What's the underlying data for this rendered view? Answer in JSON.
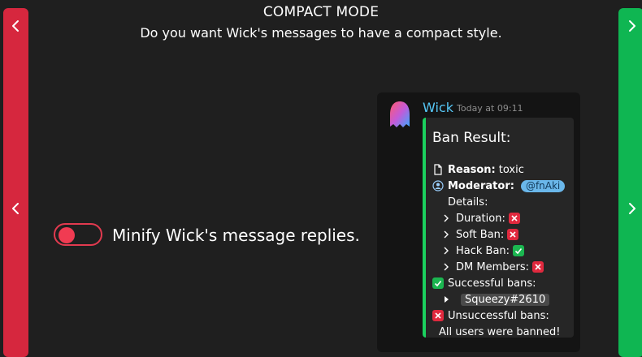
{
  "header": {
    "title": "COMPACT MODE",
    "subtitle": "Do you want Wick's messages to have a compact style."
  },
  "colors": {
    "left_nav": "#d6273e",
    "right_nav": "#0fb652",
    "toggle_off": "#e23a4f",
    "username": "#56c7f6",
    "embed_accent": "#1bd05e"
  },
  "toggle": {
    "label": "Minify Wick's message replies.",
    "state": "off"
  },
  "preview": {
    "username": "Wick",
    "timestamp": "Today at 09:11",
    "embed": {
      "title": "Ban Result:",
      "reason_label": "Reason:",
      "reason_value": "toxic",
      "moderator_label": "Moderator:",
      "moderator_value": "@fnAki",
      "details_label": "Details:",
      "duration_label": "Duration:",
      "duration_status": "x",
      "softban_label": "Soft Ban:",
      "softban_status": "x",
      "hackban_label": "Hack Ban:",
      "hackban_status": "check",
      "dm_label": "DM Members:",
      "dm_status": "x",
      "successful_label": "Successful bans:",
      "successful_user": "Squeezy#2610",
      "unsuccessful_label": "Unsuccessful bans:",
      "all_banned": "All users were banned!"
    }
  },
  "icons": [
    "chevron-left-icon",
    "chevron-right-icon",
    "file-icon",
    "user-circle-icon",
    "chevron-right-small-icon",
    "x-badge-icon",
    "check-badge-icon",
    "caret-right-icon"
  ]
}
